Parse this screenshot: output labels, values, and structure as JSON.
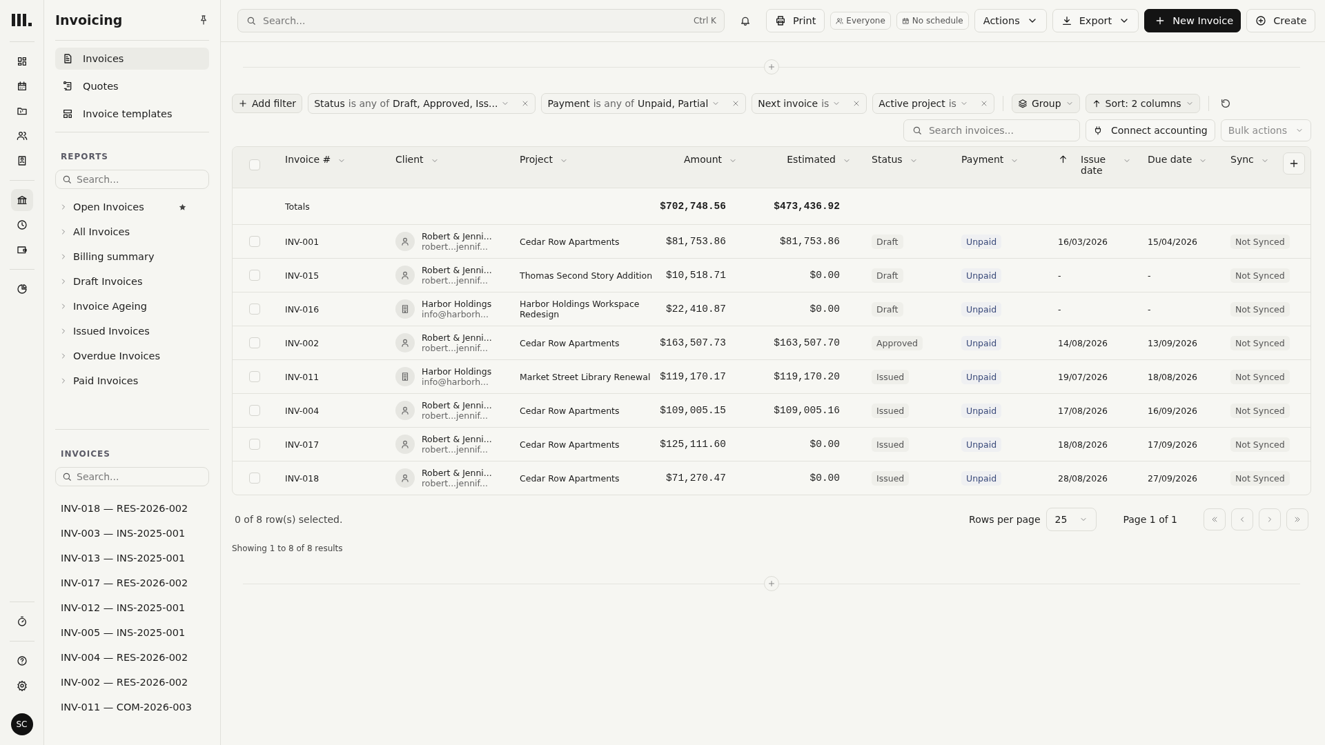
{
  "rail": {
    "groups": [
      {
        "items": [
          {
            "kind": "grid",
            "selected": false
          },
          {
            "kind": "calendar",
            "selected": false
          },
          {
            "kind": "folder",
            "selected": false
          },
          {
            "kind": "users",
            "selected": false
          },
          {
            "kind": "contact",
            "selected": false
          }
        ]
      },
      {
        "items": [
          {
            "kind": "bank",
            "selected": true
          },
          {
            "kind": "clock",
            "selected": false
          },
          {
            "kind": "wallet",
            "selected": false
          }
        ]
      },
      {
        "items": [
          {
            "kind": "pie",
            "selected": false
          }
        ]
      }
    ],
    "bottom_groups": [
      {
        "items": [
          {
            "kind": "timer",
            "selected": false
          }
        ]
      },
      {
        "items": [
          {
            "kind": "help",
            "selected": false
          },
          {
            "kind": "gear",
            "selected": false
          }
        ]
      }
    ],
    "avatar": "SC"
  },
  "sidebar": {
    "title": "Invoicing",
    "nav": [
      {
        "label": "Invoices",
        "kind": "document",
        "selected": true
      },
      {
        "label": "Quotes",
        "kind": "scroll",
        "selected": false
      },
      {
        "label": "Invoice templates",
        "kind": "layout",
        "selected": false
      }
    ],
    "reports": {
      "heading": "REPORTS",
      "placeholder": "Search...",
      "items": [
        {
          "label": "Open Invoices",
          "starred": true
        },
        {
          "label": "All Invoices",
          "starred": false
        },
        {
          "label": "Billing summary",
          "starred": false
        },
        {
          "label": "Draft Invoices",
          "starred": false
        },
        {
          "label": "Invoice Ageing",
          "starred": false
        },
        {
          "label": "Issued Invoices",
          "starred": false
        },
        {
          "label": "Overdue Invoices",
          "starred": false
        },
        {
          "label": "Paid Invoices",
          "starred": false
        }
      ]
    },
    "invoices": {
      "heading": "INVOICES",
      "placeholder": "Search...",
      "items": [
        "INV-018 — RES-2026-002",
        "INV-003 — INS-2025-001",
        "INV-013 — INS-2025-001",
        "INV-017 — RES-2026-002",
        "INV-012 — INS-2025-001",
        "INV-005 — INS-2025-001",
        "INV-004 — RES-2026-002",
        "INV-002 — RES-2026-002",
        "INV-011 — COM-2026-003"
      ]
    }
  },
  "topbar": {
    "search": {
      "placeholder": "Search...",
      "shortcut": "Ctrl K"
    },
    "buttons": [
      {
        "label": "Print",
        "kind": "print"
      },
      {
        "label": "Everyone",
        "kind": "audience"
      },
      {
        "label": "No schedule",
        "kind": "schedule"
      },
      {
        "label": "Actions",
        "kind": "actions"
      },
      {
        "label": "Export",
        "kind": "export"
      },
      {
        "label": "New Invoice",
        "kind": "new"
      },
      {
        "label": "Create",
        "kind": "create"
      }
    ]
  },
  "filters": {
    "add_label": "Add filter",
    "chips": [
      {
        "field": "Status",
        "op": "is any of",
        "value": "Draft, Approved, Iss..."
      },
      {
        "field": "Payment",
        "op": "is any of",
        "value": "Unpaid, Partial"
      },
      {
        "field": "Next invoice",
        "op": "is"
      },
      {
        "field": "Active project",
        "op": "is"
      }
    ],
    "group": "Group",
    "sort": "Sort: 2 columns",
    "search_placeholder": "Search invoices...",
    "connect": "Connect accounting",
    "bulk": {
      "label": "Bulk actions",
      "disabled": true
    }
  },
  "table": {
    "select_all": {
      "checked": false
    },
    "columns": [
      {
        "label": "Invoice #",
        "sorted": false
      },
      {
        "label": "Client",
        "sorted": false
      },
      {
        "label": "Project",
        "sorted": false
      },
      {
        "label": "Amount",
        "sorted": false
      },
      {
        "label": "Estimated",
        "sorted": false
      },
      {
        "label": "Status",
        "sorted": false
      },
      {
        "label": "Payment",
        "sorted": false
      },
      {
        "label": "Issue date",
        "sorted": true
      },
      {
        "label": "Due date",
        "sorted": false
      },
      {
        "label": "Sync",
        "sorted": false
      }
    ],
    "totals": {
      "label": "Totals",
      "amount": "$702,748.56",
      "estimated": "$473,436.92"
    },
    "rows": [
      {
        "selected": false,
        "invoice": "INV-001",
        "client": "Robert & Jenni...",
        "email": "robert...jennif...",
        "kind": "person",
        "project": "Cedar Row Apartments",
        "amount": "$81,753.86",
        "estimated": "$81,753.86",
        "status": "Draft",
        "payment": "Unpaid",
        "issue": "16/03/2026",
        "due": "15/04/2026",
        "sync": "Not Synced"
      },
      {
        "selected": false,
        "invoice": "INV-015",
        "client": "Robert & Jenni...",
        "email": "robert...jennif...",
        "kind": "person",
        "project": "Thomas Second Story Addition",
        "amount": "$10,518.71",
        "estimated": "$0.00",
        "status": "Draft",
        "payment": "Unpaid",
        "issue": "-",
        "due": "-",
        "sync": "Not Synced"
      },
      {
        "selected": false,
        "invoice": "INV-016",
        "client": "Harbor Holdings",
        "email": "info@harborh...",
        "kind": "company",
        "project": "Harbor Holdings Workspace Redesign",
        "amount": "$22,410.87",
        "estimated": "$0.00",
        "status": "Draft",
        "payment": "Unpaid",
        "issue": "-",
        "due": "-",
        "sync": "Not Synced"
      },
      {
        "selected": false,
        "invoice": "INV-002",
        "client": "Robert & Jenni...",
        "email": "robert...jennif...",
        "kind": "person",
        "project": "Cedar Row Apartments",
        "amount": "$163,507.73",
        "estimated": "$163,507.70",
        "status": "Approved",
        "payment": "Unpaid",
        "issue": "14/08/2026",
        "due": "13/09/2026",
        "sync": "Not Synced"
      },
      {
        "selected": false,
        "invoice": "INV-011",
        "client": "Harbor Holdings",
        "email": "info@harborh...",
        "kind": "company",
        "project": "Market Street Library Renewal",
        "amount": "$119,170.17",
        "estimated": "$119,170.20",
        "status": "Issued",
        "payment": "Unpaid",
        "issue": "19/07/2026",
        "due": "18/08/2026",
        "sync": "Not Synced"
      },
      {
        "selected": false,
        "invoice": "INV-004",
        "client": "Robert & Jenni...",
        "email": "robert...jennif...",
        "kind": "person",
        "project": "Cedar Row Apartments",
        "amount": "$109,005.15",
        "estimated": "$109,005.16",
        "status": "Issued",
        "payment": "Unpaid",
        "issue": "17/08/2026",
        "due": "16/09/2026",
        "sync": "Not Synced"
      },
      {
        "selected": false,
        "invoice": "INV-017",
        "client": "Robert & Jenni...",
        "email": "robert...jennif...",
        "kind": "person",
        "project": "Cedar Row Apartments",
        "amount": "$125,111.60",
        "estimated": "$0.00",
        "status": "Issued",
        "payment": "Unpaid",
        "issue": "18/08/2026",
        "due": "17/09/2026",
        "sync": "Not Synced"
      },
      {
        "selected": false,
        "invoice": "INV-018",
        "client": "Robert & Jenni...",
        "email": "robert...jennif...",
        "kind": "person",
        "project": "Cedar Row Apartments",
        "amount": "$71,270.47",
        "estimated": "$0.00",
        "status": "Issued",
        "payment": "Unpaid",
        "issue": "28/08/2026",
        "due": "27/09/2026",
        "sync": "Not Synced"
      }
    ]
  },
  "footer": {
    "selection": "0 of 8 row(s) selected.",
    "rows_per_page_label": "Rows per page",
    "rows_per_page": "25",
    "page": "Page 1 of 1",
    "showing": "Showing 1 to 8 of 8 results"
  }
}
